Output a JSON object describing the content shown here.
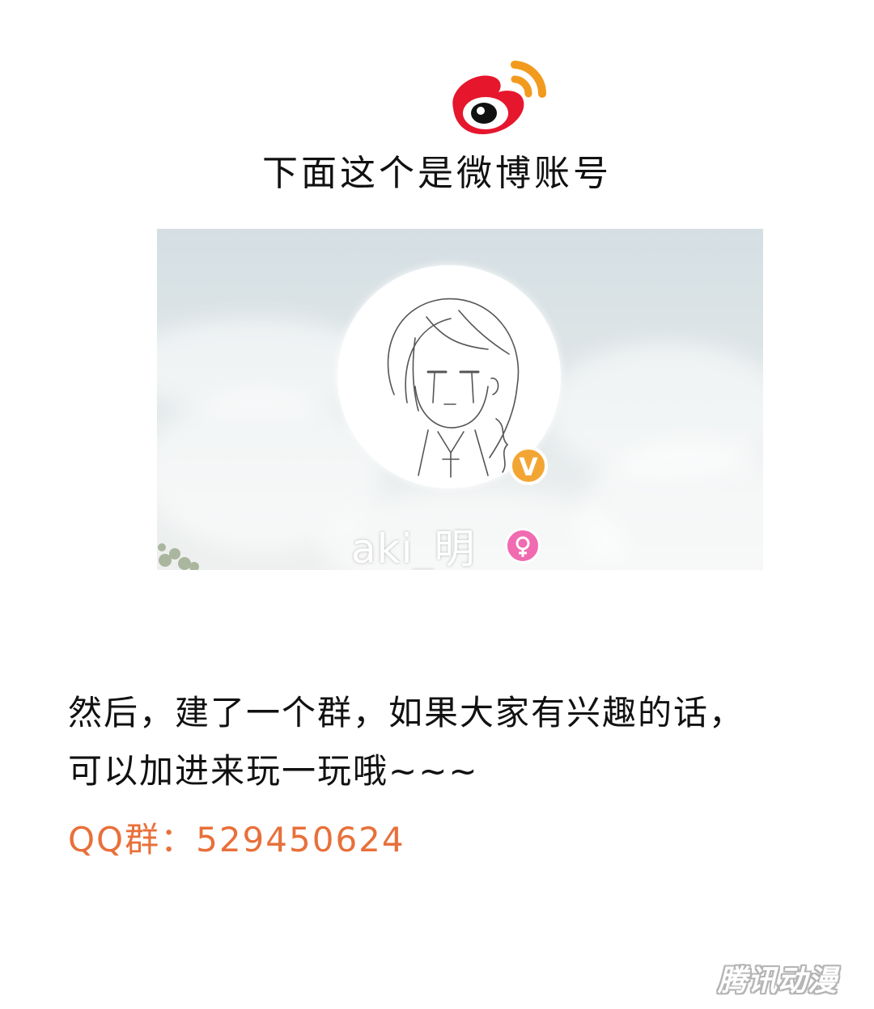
{
  "heading": "下面这个是微博账号",
  "profile": {
    "username": "aki_明",
    "verified_mark": "V"
  },
  "body": {
    "line1": "然后，建了一个群，如果大家有兴趣的话，",
    "line2": "可以加进来玩一玩哦~~~",
    "qq_group": "QQ群：529450624"
  },
  "watermark": "腾讯动漫",
  "icons": {
    "logo": "weibo-logo-icon",
    "verified": "verified-badge-icon",
    "gender": "female-icon"
  },
  "colors": {
    "weibo_red": "#e6162d",
    "weibo_orange": "#f29a1d",
    "qq_text": "#e8703a",
    "verified": "#f3a533",
    "female": "#f06bb0"
  }
}
